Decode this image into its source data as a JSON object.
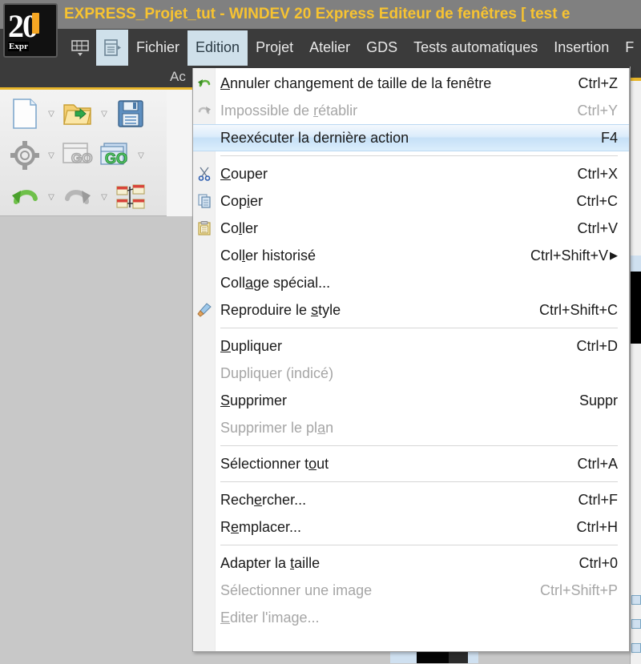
{
  "window": {
    "title": "EXPRESS_Projet_tut - WINDEV 20 Express  Editeur de fenêtres [ test e",
    "logo_text": "20",
    "logo_sub": "Expr"
  },
  "menubar": {
    "icons": [
      {
        "name": "table-view-icon"
      },
      {
        "name": "panel-view-icon"
      }
    ],
    "items": [
      {
        "label": "Fichier",
        "selected": false
      },
      {
        "label": "Edition",
        "selected": true
      },
      {
        "label": "Projet",
        "selected": false
      },
      {
        "label": "Atelier",
        "selected": false
      },
      {
        "label": "GDS",
        "selected": false
      },
      {
        "label": "Tests automatiques",
        "selected": false
      },
      {
        "label": "Insertion",
        "selected": false
      },
      {
        "label": "F",
        "selected": false
      }
    ]
  },
  "ribbon": {
    "partial_label": "Ac",
    "tools": [
      {
        "name": "new-document-icon",
        "has_arrow": true
      },
      {
        "name": "open-folder-icon",
        "has_arrow": true
      },
      {
        "name": "save-icon",
        "has_arrow": false
      },
      {
        "name": "gear-settings-icon",
        "has_arrow": true
      },
      {
        "name": "go-window-disabled-icon",
        "has_arrow": false
      },
      {
        "name": "go-project-icon",
        "has_arrow": true
      },
      {
        "name": "undo-icon",
        "has_arrow": true
      },
      {
        "name": "redo-icon",
        "has_arrow": true
      },
      {
        "name": "align-objects-icon",
        "has_arrow": false
      }
    ]
  },
  "edition_menu": {
    "items": [
      {
        "type": "item",
        "label": "Annuler changement de taille de la fenêtre",
        "accel": "Ctrl+Z",
        "icon": "undo-icon",
        "disabled": false,
        "highlight": false,
        "mnemonic_index": 0
      },
      {
        "type": "item",
        "label": "Impossible de rétablir",
        "accel": "Ctrl+Y",
        "icon": "redo-icon",
        "disabled": true,
        "highlight": false,
        "mnemonic_index": 14
      },
      {
        "type": "item",
        "label": "Reexécuter la dernière action",
        "accel": "F4",
        "icon": "",
        "disabled": false,
        "highlight": true,
        "mnemonic_index": -1
      },
      {
        "type": "separator"
      },
      {
        "type": "item",
        "label": "Couper",
        "accel": "Ctrl+X",
        "icon": "scissors-icon",
        "disabled": false,
        "highlight": false,
        "mnemonic_index": 0
      },
      {
        "type": "item",
        "label": "Copier",
        "accel": "Ctrl+C",
        "icon": "copy-icon",
        "disabled": false,
        "highlight": false,
        "mnemonic_index": 3
      },
      {
        "type": "item",
        "label": "Coller",
        "accel": "Ctrl+V",
        "icon": "clipboard-paste-icon",
        "disabled": false,
        "highlight": false,
        "mnemonic_index": 2
      },
      {
        "type": "item",
        "label": "Coller historisé",
        "accel": "Ctrl+Shift+V",
        "submenu": true,
        "icon": "",
        "disabled": false,
        "highlight": false,
        "mnemonic_index": 3
      },
      {
        "type": "item",
        "label": "Collage spécial...",
        "accel": "",
        "icon": "",
        "disabled": false,
        "highlight": false,
        "mnemonic_index": 4
      },
      {
        "type": "item",
        "label": "Reproduire le style",
        "accel": "Ctrl+Shift+C",
        "icon": "format-painter-icon",
        "disabled": false,
        "highlight": false,
        "mnemonic_index": 14
      },
      {
        "type": "separator"
      },
      {
        "type": "item",
        "label": "Dupliquer",
        "accel": "Ctrl+D",
        "icon": "",
        "disabled": false,
        "highlight": false,
        "mnemonic_index": 0
      },
      {
        "type": "item",
        "label": "Dupliquer (indicé)",
        "accel": "",
        "icon": "",
        "disabled": true,
        "highlight": false,
        "mnemonic_index": -1
      },
      {
        "type": "item",
        "label": "Supprimer",
        "accel": "Suppr",
        "icon": "",
        "disabled": false,
        "highlight": false,
        "mnemonic_index": 0
      },
      {
        "type": "item",
        "label": "Supprimer le plan",
        "accel": "",
        "icon": "",
        "disabled": true,
        "highlight": false,
        "mnemonic_index": 15
      },
      {
        "type": "separator"
      },
      {
        "type": "item",
        "label": "Sélectionner tout",
        "accel": "Ctrl+A",
        "icon": "",
        "disabled": false,
        "highlight": false,
        "mnemonic_index": 14
      },
      {
        "type": "separator"
      },
      {
        "type": "item",
        "label": "Rechercher...",
        "accel": "Ctrl+F",
        "icon": "",
        "disabled": false,
        "highlight": false,
        "mnemonic_index": 4
      },
      {
        "type": "item",
        "label": "Remplacer...",
        "accel": "Ctrl+H",
        "icon": "",
        "disabled": false,
        "highlight": false,
        "mnemonic_index": 1
      },
      {
        "type": "separator"
      },
      {
        "type": "item",
        "label": "Adapter la taille",
        "accel": "Ctrl+0",
        "icon": "",
        "disabled": false,
        "highlight": false,
        "mnemonic_index": 11
      },
      {
        "type": "item",
        "label": "Sélectionner une image",
        "accel": "Ctrl+Shift+P",
        "icon": "",
        "disabled": true,
        "highlight": false,
        "mnemonic_index": -1
      },
      {
        "type": "item",
        "label": "Editer l'image...",
        "accel": "",
        "icon": "",
        "disabled": true,
        "highlight": false,
        "mnemonic_index": 0
      }
    ]
  },
  "colors": {
    "titlebar_bg": "#808080",
    "title_text": "#f7c331",
    "menubar_bg": "#3b3b3b",
    "menu_selected_bg": "#cfe0ea",
    "accent_gold": "#e8b62a",
    "menu_bg": "#ffffff",
    "menu_gutter": "#f1f1f1",
    "highlight_blue": "#c6e0f7",
    "disabled_text": "#a6a6a6",
    "workspace_bg": "#c8c8c8"
  }
}
